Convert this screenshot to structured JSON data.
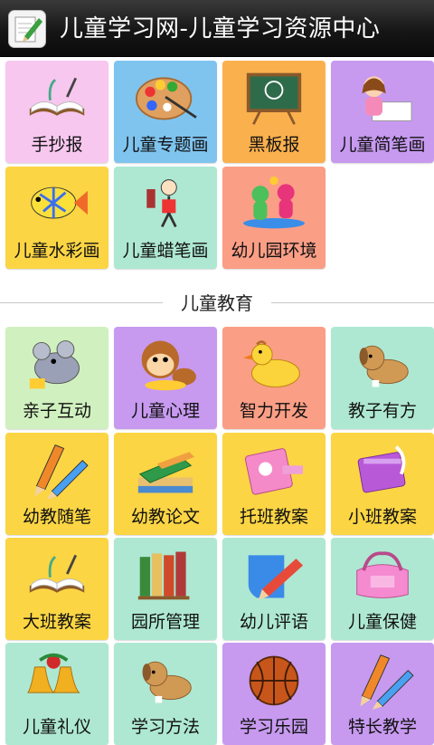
{
  "app": {
    "title": "儿童学习网-儿童学习资源中心",
    "icon": "pencil-notepad-icon"
  },
  "colors": {
    "pink": "#f7c7ef",
    "blue": "#7fc4ef",
    "orange": "#fbb04e",
    "purple": "#c79af0",
    "yellow": "#fbd544",
    "mint": "#aee8d3",
    "salmon": "#fb9e86",
    "lightgreen": "#d0f1bf",
    "title_bar": "#1a1a1a"
  },
  "top_tiles": [
    {
      "label": "手抄报",
      "icon": "open-book-icon",
      "color": "pink"
    },
    {
      "label": "儿童专题画",
      "icon": "paint-palette-icon",
      "color": "blue"
    },
    {
      "label": "黑板报",
      "icon": "chalkboard-icon",
      "color": "orange"
    },
    {
      "label": "儿童简笔画",
      "icon": "girl-drawing-icon",
      "color": "purple"
    },
    {
      "label": "儿童水彩画",
      "icon": "fish-icon",
      "color": "yellow"
    },
    {
      "label": "儿童蜡笔画",
      "icon": "crayon-kid-icon",
      "color": "mint"
    },
    {
      "label": "幼儿园环境",
      "icon": "kids-playing-icon",
      "color": "salmon"
    }
  ],
  "section": {
    "title": "儿童教育"
  },
  "edu_tiles": [
    {
      "label": "亲子互动",
      "icon": "mouse-icon",
      "color": "lightgreen"
    },
    {
      "label": "儿童心理",
      "icon": "monkey-icon",
      "color": "purple"
    },
    {
      "label": "智力开发",
      "icon": "duck-icon",
      "color": "salmon"
    },
    {
      "label": "教子有方",
      "icon": "puppy-icon",
      "color": "mint"
    },
    {
      "label": "幼教随笔",
      "icon": "pencils-icon",
      "color": "yellow"
    },
    {
      "label": "幼教论文",
      "icon": "green-books-icon",
      "color": "yellow"
    },
    {
      "label": "托班教案",
      "icon": "pink-notebook-icon",
      "color": "yellow"
    },
    {
      "label": "小班教案",
      "icon": "purple-diary-icon",
      "color": "yellow"
    },
    {
      "label": "大班教案",
      "icon": "open-book-icon",
      "color": "yellow"
    },
    {
      "label": "园所管理",
      "icon": "bookshelf-icon",
      "color": "mint"
    },
    {
      "label": "幼儿评语",
      "icon": "pencil-paper-icon",
      "color": "mint"
    },
    {
      "label": "儿童保健",
      "icon": "pink-bag-icon",
      "color": "mint"
    },
    {
      "label": "儿童礼仪",
      "icon": "bells-icon",
      "color": "mint"
    },
    {
      "label": "学习方法",
      "icon": "puppy-icon",
      "color": "mint"
    },
    {
      "label": "学习乐园",
      "icon": "basketball-icon",
      "color": "purple"
    },
    {
      "label": "特长教学",
      "icon": "pencils-icon",
      "color": "purple"
    }
  ]
}
